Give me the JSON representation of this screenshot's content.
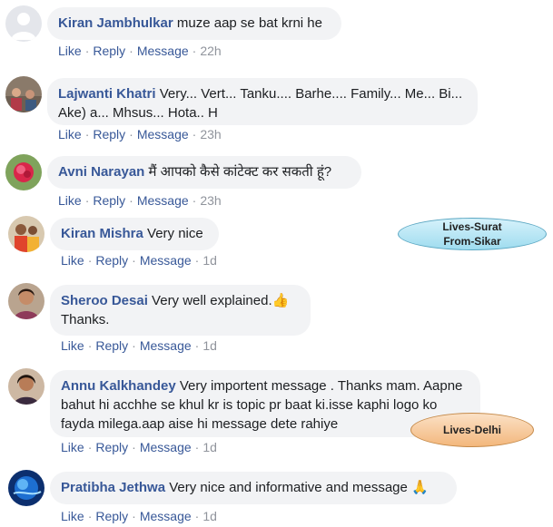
{
  "actions": {
    "like": "Like",
    "reply": "Reply",
    "message": "Message",
    "sep": "·"
  },
  "comments": [
    {
      "author": "Kiran Jambhulkar",
      "text": "muze aap se bat krni he",
      "time": "22h"
    },
    {
      "author": "Lajwanti Khatri",
      "text": "Very... Vert... Tanku.... Barhe.... Family... Me... Bi... Ake) a... Mhsus... Hota.. H",
      "time": "23h"
    },
    {
      "author": "Avni Narayan",
      "text": "मैं आपको कैसे कांटेक्ट कर सकती हूं?",
      "time": "23h"
    },
    {
      "author": "Kiran Mishra",
      "text": "Very nice",
      "time": "1d"
    },
    {
      "author": "Sheroo Desai",
      "text": "Very well explained.",
      "text2": "Thanks.",
      "emoji": "👍",
      "time": "1d"
    },
    {
      "author": "Annu Kalkhandey",
      "text": "Very importent message . Thanks mam. Aapne bahut hi acchhe se khul kr is topic pr baat ki.isse kaphi logo ko fayda milega.aap aise hi message dete rahiye",
      "time": "1d"
    },
    {
      "author": "Pratibha Jethwa",
      "text": "Very nice and informative and message",
      "emoji": "🙏",
      "time": "1d"
    }
  ],
  "annotations": {
    "surat": {
      "line1": "Lives-Surat",
      "line2": "From-Sikar"
    },
    "delhi": {
      "line1": "Lives-Delhi"
    }
  },
  "colors": {
    "author": "#385898",
    "bubble": "#f2f3f5",
    "meta": "#90949c"
  }
}
